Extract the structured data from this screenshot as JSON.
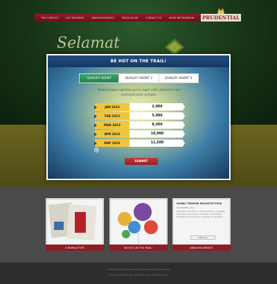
{
  "site": {
    "nav": [
      "THE CONTEST",
      "GET REWARDS",
      "ANNOUNCEMENTS",
      "MEDIA ROOM",
      "CONTACT US",
      "MORE INFORMATION"
    ],
    "logo_text": "PRUDENTIAL",
    "hero_text": "Selamat"
  },
  "modal": {
    "title": "BE HOT ON THE TRAIL!",
    "tabs": [
      "QUALIFY AGENT",
      "QUALIFY AGENT 2",
      "QUALIFY AGENT 3"
    ],
    "active_tab": 0,
    "intro": "Pellentesque egestas purus eget nibh dignissim non euismod ante semper.",
    "rows": [
      {
        "month": "JAN 2013",
        "value": "2,000"
      },
      {
        "month": "FEB 2013",
        "value": "5,000"
      },
      {
        "month": "MAR 2013",
        "value": "8,500"
      },
      {
        "month": "APR 2013",
        "value": "10,000"
      },
      {
        "month": "MAY 2013",
        "value": "11,500"
      }
    ],
    "add_symbol": "+",
    "submit_label": "SUBMIT"
  },
  "cards": [
    {
      "label": "E-NEWSLETTER"
    },
    {
      "label": "BE HOT ON THE TRAIL!"
    },
    {
      "label": "ANNOUNCEMENTS",
      "title": "DONEC TEMPOR MOLESTIE FEUS",
      "date": "NOVEMBER 2013",
      "body": "Duis aute irure dolor in reprehenderit in voluptate velit esse cillum dolore eu fugiat nulla pariatur. Excepteur sint occaecat cupidatat non proident.",
      "view_all": "VIEW ALL"
    }
  ],
  "footer": {
    "line1": "COPYRIGHT © PRUDENTIAL ASSURANCE MALAYSIA BERHAD",
    "line2": "ALL RIGHTS RESERVED. TERMS OF USE | PRIVACY POLICY"
  },
  "colors": {
    "brand_red": "#8e1c26",
    "tab_active": "#2a8f5a",
    "month_yellow": "#f0c53a",
    "header_blue": "#1d4a7c"
  }
}
